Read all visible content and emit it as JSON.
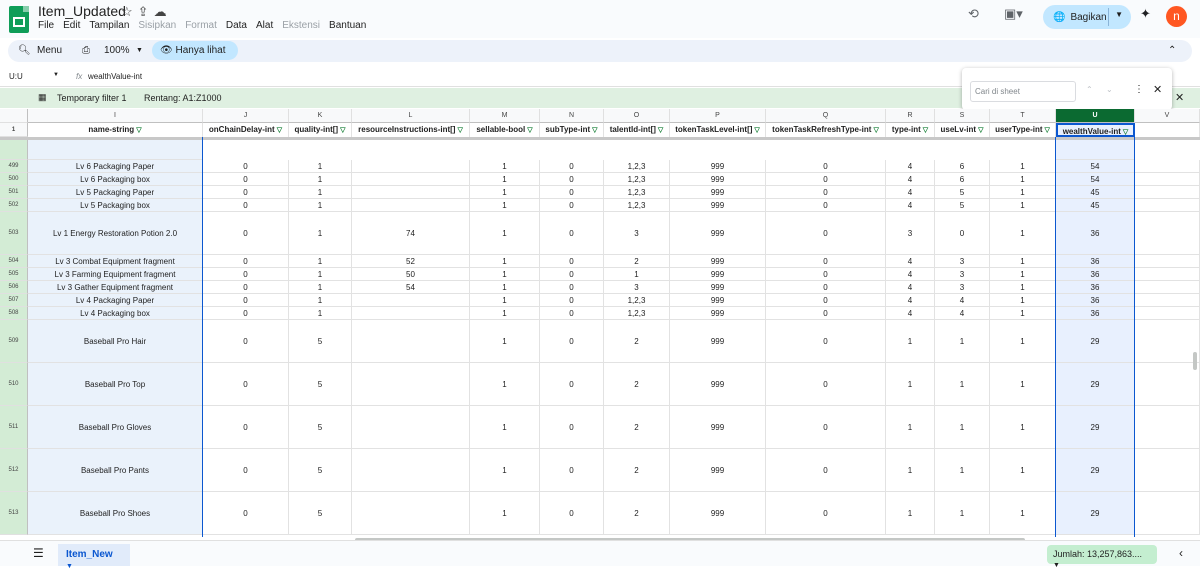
{
  "app": {
    "title": "Item_Updated",
    "menus": [
      "File",
      "Edit",
      "Tampilan",
      "Sisipkan",
      "Format",
      "Data",
      "Alat",
      "Ekstensi",
      "Bantuan"
    ],
    "dim_menus": [
      "Sisipkan",
      "Format",
      "Ekstensi"
    ],
    "share": "Bagikan",
    "avatar": "n"
  },
  "toolbar": {
    "menu": "Menu",
    "zoom": "100%",
    "view_only": "Hanya lihat"
  },
  "formula": {
    "cell_ref": "U:U",
    "content": "wealthValue-int"
  },
  "filter": {
    "label": "Temporary filter 1",
    "range": "Rentang:  A1:Z1000"
  },
  "find": {
    "placeholder": "Cari di sheet"
  },
  "columns": [
    {
      "letter": "I",
      "header": "name-string"
    },
    {
      "letter": "J",
      "header": "onChainDelay-int"
    },
    {
      "letter": "K",
      "header": "quality-int[]"
    },
    {
      "letter": "L",
      "header": "resourceInstructions-int[]"
    },
    {
      "letter": "M",
      "header": "sellable-bool"
    },
    {
      "letter": "N",
      "header": "subType-int"
    },
    {
      "letter": "O",
      "header": "talentId-int[]"
    },
    {
      "letter": "P",
      "header": "tokenTaskLevel-int[]"
    },
    {
      "letter": "Q",
      "header": "tokenTaskRefreshType-int"
    },
    {
      "letter": "R",
      "header": "type-int"
    },
    {
      "letter": "S",
      "header": "useLv-int"
    },
    {
      "letter": "T",
      "header": "userType-int"
    },
    {
      "letter": "U",
      "header": "wealthValue-int"
    },
    {
      "letter": "V",
      "header": ""
    }
  ],
  "header_row_num": "1",
  "rows": [
    {
      "num": "499",
      "cells": [
        "Lv 6 Packaging Paper",
        "0",
        "1",
        "",
        "1",
        "0",
        "1,2,3",
        "999",
        "0",
        "4",
        "6",
        "1",
        "54",
        ""
      ]
    },
    {
      "num": "500",
      "cells": [
        "Lv 6 Packaging box",
        "0",
        "1",
        "",
        "1",
        "0",
        "1,2,3",
        "999",
        "0",
        "4",
        "6",
        "1",
        "54",
        ""
      ]
    },
    {
      "num": "501",
      "cells": [
        "Lv 5 Packaging Paper",
        "0",
        "1",
        "",
        "1",
        "0",
        "1,2,3",
        "999",
        "0",
        "4",
        "5",
        "1",
        "45",
        ""
      ]
    },
    {
      "num": "502",
      "cells": [
        "Lv 5 Packaging box",
        "0",
        "1",
        "",
        "1",
        "0",
        "1,2,3",
        "999",
        "0",
        "4",
        "5",
        "1",
        "45",
        ""
      ]
    },
    {
      "num": "503",
      "cells": [
        "Lv 1 Energy Restoration Potion 2.0",
        "0",
        "1",
        "74",
        "1",
        "0",
        "3",
        "999",
        "0",
        "3",
        "0",
        "1",
        "36",
        ""
      ]
    },
    {
      "num": "504",
      "cells": [
        "Lv 3 Combat Equipment fragment",
        "0",
        "1",
        "52",
        "1",
        "0",
        "2",
        "999",
        "0",
        "4",
        "3",
        "1",
        "36",
        ""
      ]
    },
    {
      "num": "505",
      "cells": [
        "Lv 3 Farming Equipment fragment",
        "0",
        "1",
        "50",
        "1",
        "0",
        "1",
        "999",
        "0",
        "4",
        "3",
        "1",
        "36",
        ""
      ]
    },
    {
      "num": "506",
      "cells": [
        "Lv 3 Gather Equipment fragment",
        "0",
        "1",
        "54",
        "1",
        "0",
        "3",
        "999",
        "0",
        "4",
        "3",
        "1",
        "36",
        ""
      ]
    },
    {
      "num": "507",
      "cells": [
        "Lv 4 Packaging Paper",
        "0",
        "1",
        "",
        "1",
        "0",
        "1,2,3",
        "999",
        "0",
        "4",
        "4",
        "1",
        "36",
        ""
      ]
    },
    {
      "num": "508",
      "cells": [
        "Lv 4 Packaging box",
        "0",
        "1",
        "",
        "1",
        "0",
        "1,2,3",
        "999",
        "0",
        "4",
        "4",
        "1",
        "36",
        ""
      ]
    },
    {
      "num": "509",
      "cells": [
        "Baseball Pro Hair",
        "0",
        "5",
        "",
        "1",
        "0",
        "2",
        "999",
        "0",
        "1",
        "1",
        "1",
        "29",
        ""
      ]
    },
    {
      "num": "510",
      "cells": [
        "Baseball Pro Top",
        "0",
        "5",
        "",
        "1",
        "0",
        "2",
        "999",
        "0",
        "1",
        "1",
        "1",
        "29",
        ""
      ]
    },
    {
      "num": "511",
      "cells": [
        "Baseball Pro Gloves",
        "0",
        "5",
        "",
        "1",
        "0",
        "2",
        "999",
        "0",
        "1",
        "1",
        "1",
        "29",
        ""
      ]
    },
    {
      "num": "512",
      "cells": [
        "Baseball Pro Pants",
        "0",
        "5",
        "",
        "1",
        "0",
        "2",
        "999",
        "0",
        "1",
        "1",
        "1",
        "29",
        ""
      ]
    },
    {
      "num": "513",
      "cells": [
        "Baseball Pro Shoes",
        "0",
        "5",
        "",
        "1",
        "0",
        "2",
        "999",
        "0",
        "1",
        "1",
        "1",
        "29",
        ""
      ]
    }
  ],
  "bottom": {
    "sheet": "Item_New",
    "sum": "Jumlah: 13,257,863...."
  },
  "colors": {
    "accent": "#0b57d0",
    "selected_header": "#0b6a31",
    "selected_col": "#e8f0fe",
    "filter_green": "#188038"
  }
}
